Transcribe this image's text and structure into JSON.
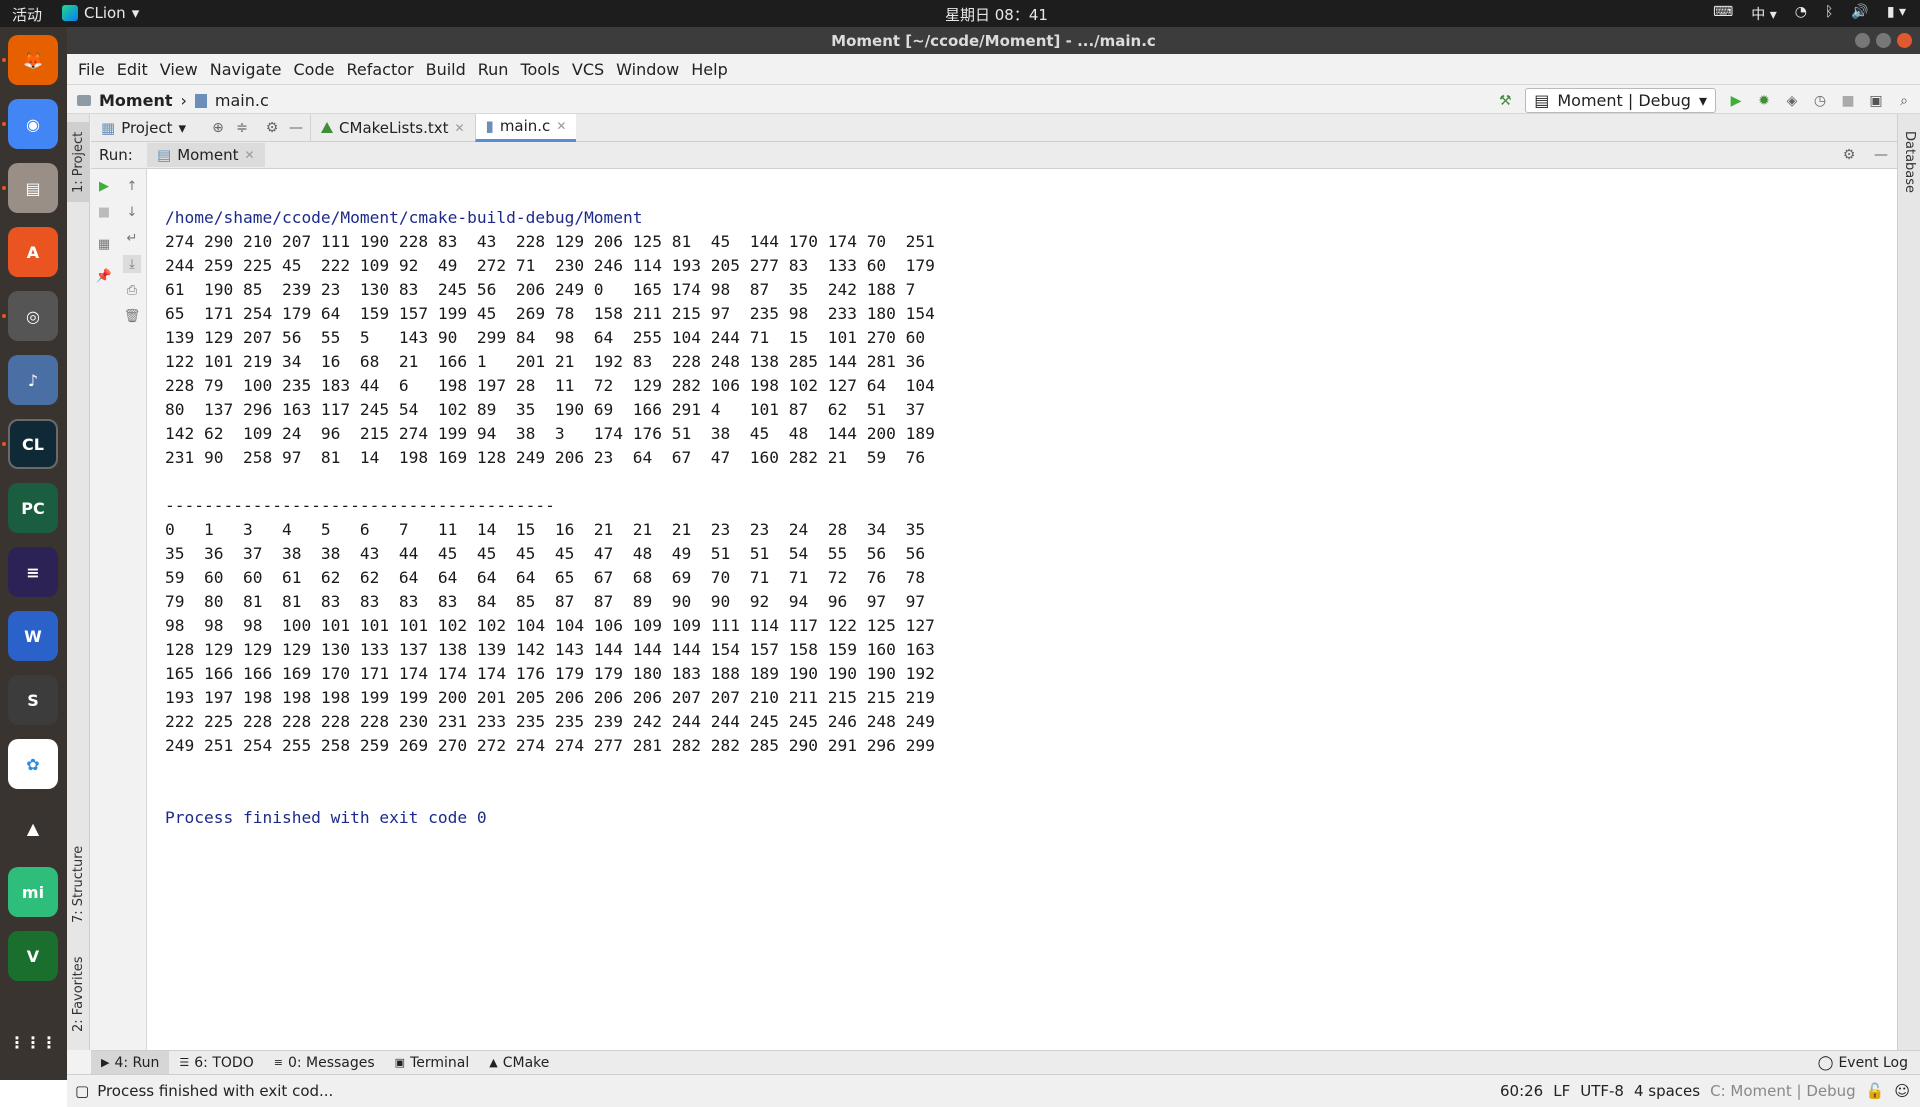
{
  "system_bar": {
    "activities": "活动",
    "app_name": "CLion",
    "clock": "星期日 08：41",
    "input_method": "中"
  },
  "dock": [
    {
      "name": "firefox",
      "color": "#e66000",
      "glyph": "🦊"
    },
    {
      "name": "chrome",
      "color": "#4285f4",
      "glyph": "◉"
    },
    {
      "name": "files",
      "color": "#9a8f86",
      "glyph": "▤"
    },
    {
      "name": "software",
      "color": "#e95420",
      "glyph": "A"
    },
    {
      "name": "speaker",
      "color": "#555",
      "glyph": "◎"
    },
    {
      "name": "music",
      "color": "#4a6fa5",
      "glyph": "♪"
    },
    {
      "name": "clion",
      "color": "#0f2a36",
      "glyph": "CL"
    },
    {
      "name": "pycharm",
      "color": "#1b5d3f",
      "glyph": "PC"
    },
    {
      "name": "eclipse",
      "color": "#2c2255",
      "glyph": "≡"
    },
    {
      "name": "wps",
      "color": "#2a62c9",
      "glyph": "W"
    },
    {
      "name": "sublime",
      "color": "#3c3c3c",
      "glyph": "S"
    },
    {
      "name": "baidu-netdisk",
      "color": "#ffffff",
      "glyph": "✿"
    },
    {
      "name": "vlc",
      "color": "#3a3430",
      "glyph": "▲"
    },
    {
      "name": "mi-chat",
      "color": "#2ebd7b",
      "glyph": "mi"
    },
    {
      "name": "vim",
      "color": "#1a6e2e",
      "glyph": "V"
    },
    {
      "name": "show-apps",
      "color": "#3a3430",
      "glyph": "⋮⋮⋮"
    }
  ],
  "window": {
    "title": "Moment [~/ccode/Moment] - .../main.c"
  },
  "menu": [
    "File",
    "Edit",
    "View",
    "Navigate",
    "Code",
    "Refactor",
    "Build",
    "Run",
    "Tools",
    "VCS",
    "Window",
    "Help"
  ],
  "breadcrumb": {
    "project": "Moment",
    "file": "main.c"
  },
  "run_config": "Moment | Debug",
  "side_tabs": {
    "project": "1: Project",
    "structure": "7: Structure",
    "favorites": "2: Favorites",
    "database": "Database"
  },
  "editor_tabs": {
    "project_selector": "Project",
    "tabs": [
      {
        "label": "CMakeLists.txt",
        "active": false
      },
      {
        "label": "main.c",
        "active": true
      }
    ]
  },
  "run_panel": {
    "label": "Run:",
    "tab": "Moment"
  },
  "console": {
    "path": "/home/shame/ccode/Moment/cmake-build-debug/Moment",
    "unsorted": [
      "274 290 210 207 111 190 228 83  43  228 129 206 125 81  45  144 170 174 70  251",
      "244 259 225 45  222 109 92  49  272 71  230 246 114 193 205 277 83  133 60  179",
      "61  190 85  239 23  130 83  245 56  206 249 0   165 174 98  87  35  242 188 7",
      "65  171 254 179 64  159 157 199 45  269 78  158 211 215 97  235 98  233 180 154",
      "139 129 207 56  55  5   143 90  299 84  98  64  255 104 244 71  15  101 270 60",
      "122 101 219 34  16  68  21  166 1   201 21  192 83  228 248 138 285 144 281 36",
      "228 79  100 235 183 44  6   198 197 28  11  72  129 282 106 198 102 127 64  104",
      "80  137 296 163 117 245 54  102 89  35  190 69  166 291 4   101 87  62  51  37",
      "142 62  109 24  96  215 274 199 94  38  3   174 176 51  38  45  48  144 200 189",
      "231 90  258 97  81  14  198 169 128 249 206 23  64  67  47  160 282 21  59  76"
    ],
    "separator": "----------------------------------------",
    "sorted": [
      "0   1   3   4   5   6   7   11  14  15  16  21  21  21  23  23  24  28  34  35",
      "35  36  37  38  38  43  44  45  45  45  45  47  48  49  51  51  54  55  56  56",
      "59  60  60  61  62  62  64  64  64  64  65  67  68  69  70  71  71  72  76  78",
      "79  80  81  81  83  83  83  83  84  85  87  87  89  90  90  92  94  96  97  97",
      "98  98  98  100 101 101 101 102 102 104 104 106 109 109 111 114 117 122 125 127",
      "128 129 129 129 130 133 137 138 139 142 143 144 144 144 154 157 158 159 160 163",
      "165 166 166 169 170 171 174 174 174 176 179 179 180 183 188 189 190 190 190 192",
      "193 197 198 198 198 199 199 200 201 205 206 206 206 207 207 210 211 215 215 219",
      "222 225 228 228 228 228 230 231 233 235 235 239 242 244 244 245 245 246 248 249",
      "249 251 254 255 258 259 269 270 272 274 274 277 281 282 282 285 290 291 296 299"
    ],
    "finished": "Process finished with exit code 0"
  },
  "tool_tabs": [
    {
      "label": "4: Run",
      "active": true,
      "icon": "▶"
    },
    {
      "label": "6: TODO",
      "active": false,
      "icon": "☰"
    },
    {
      "label": "0: Messages",
      "active": false,
      "icon": "≡"
    },
    {
      "label": "Terminal",
      "active": false,
      "icon": "▣"
    },
    {
      "label": "CMake",
      "active": false,
      "icon": "▲"
    }
  ],
  "event_log": "Event Log",
  "status": {
    "message": "Process finished with exit cod...",
    "position": "60:26",
    "line_sep": "LF",
    "encoding": "UTF-8",
    "indent": "4 spaces",
    "context": "C: Moment | Debug"
  }
}
